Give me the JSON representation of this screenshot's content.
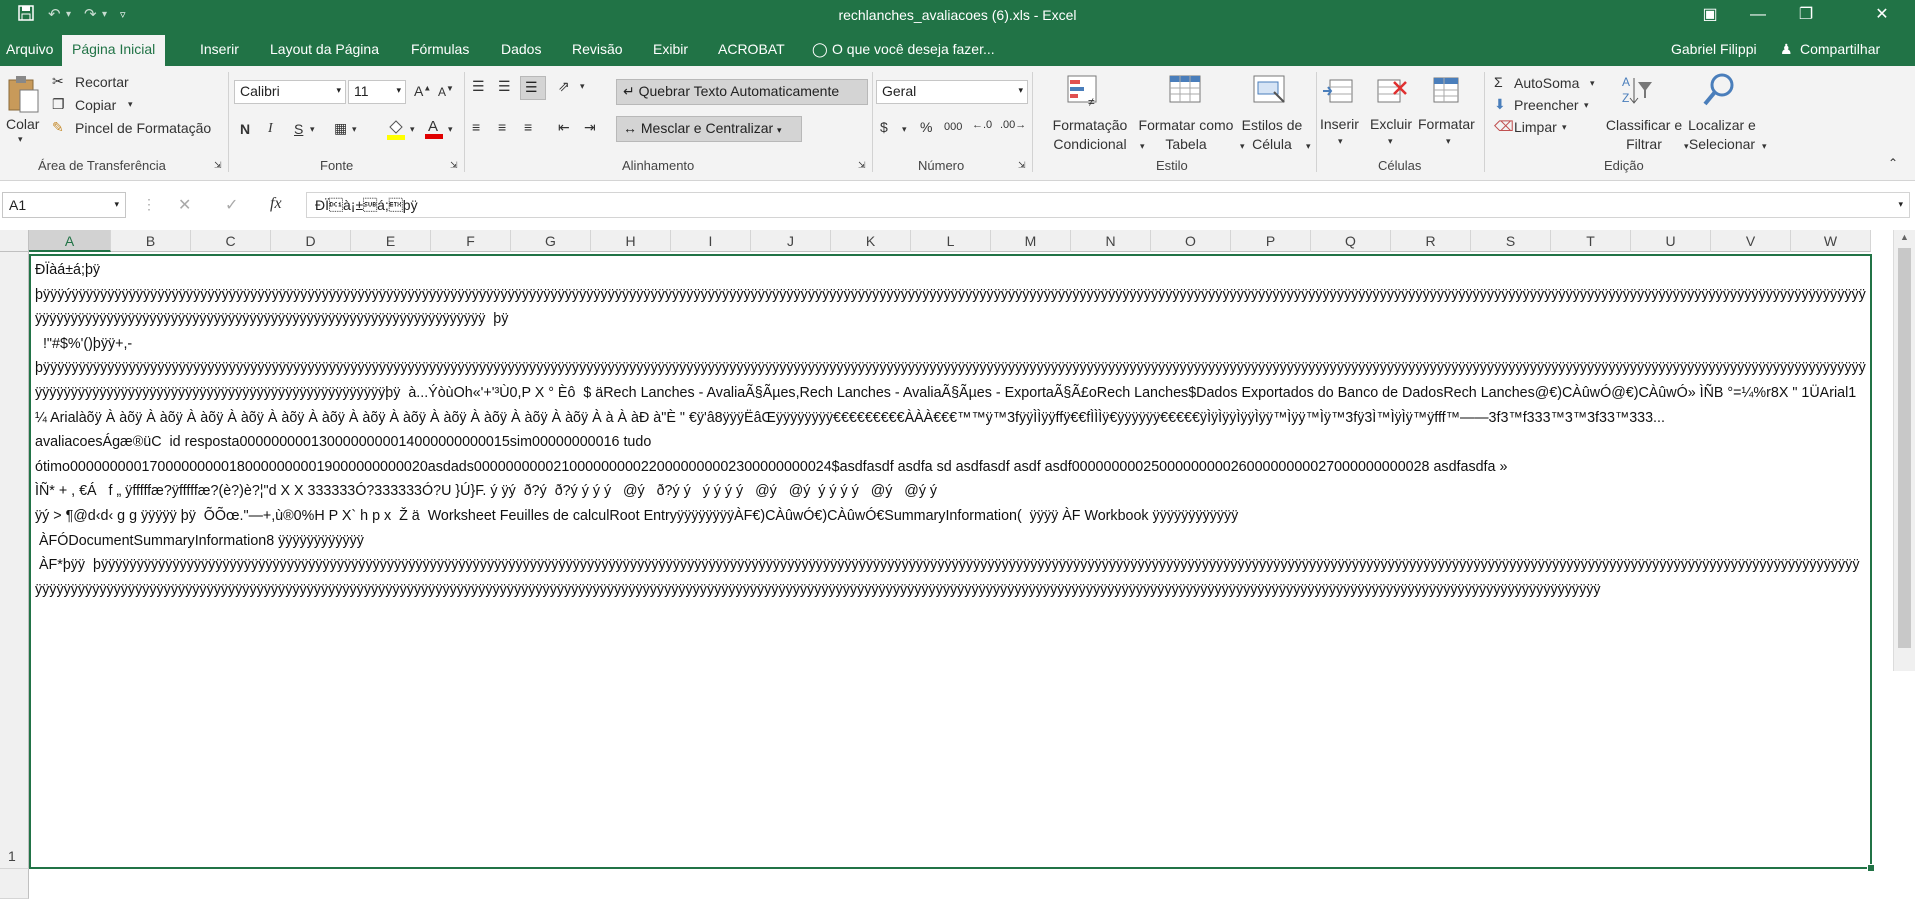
{
  "window": {
    "title": "rechlanches_avaliacoes (6).xls  -  Excel",
    "qa_icons": [
      "save-icon",
      "undo-icon",
      "redo-icon",
      "customize-icon"
    ]
  },
  "menu": {
    "tabs": [
      "Arquivo",
      "Página Inicial",
      "Inserir",
      "Layout da Página",
      "Fórmulas",
      "Dados",
      "Revisão",
      "Exibir",
      "ACROBAT"
    ],
    "tellme": "O que você deseja fazer...",
    "user": "Gabriel Filippi",
    "share": "Compartilhar"
  },
  "ribbon": {
    "clipboard": {
      "paste": "Colar",
      "cut": "Recortar",
      "copy": "Copiar",
      "format_painter": "Pincel de Formatação",
      "group": "Área de Transferência"
    },
    "font": {
      "name": "Calibri",
      "size": "11",
      "group": "Fonte",
      "bold": "N",
      "italic": "I",
      "underline": "S"
    },
    "alignment": {
      "wrap": "Quebrar Texto Automaticamente",
      "merge": "Mesclar e Centralizar",
      "group": "Alinhamento"
    },
    "number": {
      "format": "Geral",
      "currency": "$",
      "percent": "%",
      "thousands": "000",
      "group": "Número"
    },
    "styles": {
      "conditional": "Formatação Condicional",
      "as_table": "Formatar como Tabela",
      "cell_styles": "Estilos de Célula",
      "group": "Estilo"
    },
    "cells": {
      "insert": "Inserir",
      "delete": "Excluir",
      "format": "Formatar",
      "group": "Células"
    },
    "editing": {
      "autosum": "AutoSoma",
      "fill": "Preencher",
      "clear": "Limpar",
      "sort": "Classificar e Filtrar",
      "find": "Localizar e Selecionar",
      "group": "Edição"
    }
  },
  "formula_bar": {
    "name_box": "A1",
    "fx": "fx",
    "content": "ÐÏ\u0011à¡±\u001aá;\u0003þÿ"
  },
  "grid": {
    "columns": [
      "A",
      "B",
      "C",
      "D",
      "E",
      "F",
      "G",
      "H",
      "I",
      "J",
      "K",
      "L",
      "M",
      "N",
      "O",
      "P",
      "Q",
      "R",
      "S",
      "T",
      "U",
      "V",
      "W"
    ],
    "row_number": "1",
    "cell_a1": "ÐÏàá±á;þÿ\nþÿÿÿýÿÿÿÿÿÿÿÿÿÿÿÿÿÿÿÿÿÿÿÿÿÿÿÿÿÿÿÿÿÿÿÿÿÿÿÿÿÿÿÿÿÿÿÿÿÿÿÿÿÿÿÿÿÿÿÿÿÿÿÿÿÿÿÿÿÿÿÿÿÿÿÿÿÿÿÿÿÿÿÿÿÿÿÿÿÿÿÿÿÿÿÿÿÿÿÿÿÿÿÿÿÿÿÿÿÿÿÿÿÿÿÿÿÿÿÿÿÿÿÿÿÿÿÿÿÿÿÿÿÿÿÿÿÿÿÿÿÿÿÿÿÿÿÿÿÿÿÿÿÿÿÿÿÿÿÿÿÿÿÿÿÿÿÿÿÿÿÿÿÿÿÿÿÿÿÿÿÿÿÿÿÿÿÿÿÿÿÿÿÿÿÿÿÿÿÿÿÿÿÿÿÿÿÿÿÿÿÿÿÿÿÿÿÿÿÿÿÿÿÿÿÿÿÿÿÿÿÿÿÿÿÿÿÿÿÿÿÿÿÿÿÿÿÿÿÿÿÿÿÿÿÿÿÿÿÿÿÿÿÿÿÿÿÿÿÿÿÿÿÿÿÿÿÿÿÿÿÿÿÿÿÿÿÿÿÿÿÿÿÿÿÿÿÿÿÿÿÿÿÿÿÿÿÿÿÿÿÿÿÿÿÿÿÿ  þÿ  \n  !\"#$%'()þÿÿ+,-\nþÿÿÿÿÿÿÿÿÿÿÿÿÿÿÿÿÿÿÿÿÿÿÿÿÿÿÿÿÿÿÿÿÿÿÿÿÿÿÿÿÿÿÿÿÿÿÿÿÿÿÿÿÿÿÿÿÿÿÿÿÿÿÿÿÿÿÿÿÿÿÿÿÿÿÿÿÿÿÿÿÿÿÿÿÿÿÿÿÿÿÿÿÿÿÿÿÿÿÿÿÿÿÿÿÿÿÿÿÿÿÿÿÿÿÿÿÿÿÿÿÿÿÿÿÿÿÿÿÿÿÿÿÿÿÿÿÿÿÿÿÿÿÿÿÿÿÿÿÿÿÿÿÿÿÿÿÿÿÿÿÿÿÿÿÿÿÿÿÿÿÿÿÿÿÿÿÿÿÿÿÿÿÿÿÿÿÿÿÿÿÿÿÿÿÿÿÿÿÿÿÿÿÿÿÿÿÿÿÿÿÿÿÿÿÿÿÿÿÿÿÿÿÿÿÿÿÿÿÿÿÿÿÿÿÿÿÿÿÿÿÿÿÿÿÿÿÿÿÿÿÿÿÿÿÿÿÿÿÿÿÿÿÿÿÿÿÿÿÿÿÿÿÿÿÿÿÿÿÿÿÿÿÿÿÿÿÿÿÿÿÿÿÿÿÿÿÿÿÿÿÿÿÿÿþÿ  à...ÝòùOh«'+'³Ù0,P X ° Èô  $ äRech Lanches - AvaliaÃ§Ãµes,Rech Lanches - AvaliaÃ§Ãµes - ExportaÃ§Ã£oRech Lanches$Dados Exportados do Banco de DadosRech Lanches@€)CÀûwÓ@€)CÀûwÓ» ÌÑB °=¼%r8X \" 1ÜArial1¼ Arialàõÿ À àõÿ À àõÿ À àõÿ À àõÿ À àõÿ À àõÿ À àõÿ À àõÿ À àõÿ À àõÿ À àõÿ À àõÿ À à À àÐ à\"È \" €ÿ'â8ÿÿÿËâŒÿÿÿÿÿÿÿÿ€€€€€€€€€ÀÀÀ€€€™™ÿ™3fÿÿÌÌÿÿffÿ€€fÌÌÌÿ€ÿÿÿÿÿÿ€€€€€ÿÌÿÌÿÿÌÿÿÌÿÿ™Ìÿÿ™Ìÿ™3fÿ3Ì™ÌÿÌÿ™ÿfff™——3f3™f333™3™3f33™333...\navaliacoesÁgæ®üC  id resposta0000000001300000000014000000000015sim00000000016 tudo\nótimo000000000170000000001800000000019000000000020asdads000000000021000000000220000000002300000000024$asdfasdf asdfa sd asdfasdf asdf asdf000000000250000000002600000000027000000000028 asdfasdfa »\nÌÑ* + , €Á   f „ ÿfffffæ?ÿfffffæ?(è?)è?¦\"d X X 333333Ó?333333Ó?U }Ú}F. ý ÿý  ð?ý  ð?ý ý ý ý   @ý   ð?ý ý   ý ý ý ý   @ý   @ý  ý ý ý ý   @ý   @ý ý\nÿý > ¶@d‹d‹ g g ÿÿÿÿÿ þÿ  ÕÕœ.\"—+,ù®0%H P X` h p x  Ž ä  Worksheet Feuilles de calculRoot EntryÿÿÿÿÿÿÿÿÀF€)CÀûwÓ€)CÀûwÓ€SummaryInformation(  ÿÿÿÿ ÀF Workbook ÿÿÿÿÿÿÿÿÿÿÿÿ\n ÀFÓDocumentSummaryInformation8 ÿÿÿÿÿÿÿÿÿÿÿÿ\n ÀF*þÿÿ  þÿÿÿÿÿÿÿÿÿÿÿÿÿÿÿÿÿÿÿÿÿÿÿÿÿÿÿÿÿÿÿÿÿÿÿÿÿÿÿÿÿÿÿÿÿÿÿÿÿÿÿÿÿÿÿÿÿÿÿÿÿÿÿÿÿÿÿÿÿÿÿÿÿÿÿÿÿÿÿÿÿÿÿÿÿÿÿÿÿÿÿÿÿÿÿÿÿÿÿÿÿÿÿÿÿÿÿÿÿÿÿÿÿÿÿÿÿÿÿÿÿÿÿÿÿÿÿÿÿÿÿÿÿÿÿÿÿÿÿÿÿÿÿÿÿÿÿÿÿÿÿÿÿÿÿÿÿÿÿÿÿÿÿÿÿÿÿÿÿÿÿÿÿÿÿÿÿÿÿÿÿÿÿÿÿÿÿÿÿÿÿÿÿÿÿÿÿÿÿÿÿÿÿÿÿÿÿÿÿÿÿÿÿÿÿÿÿÿÿÿÿÿÿÿÿÿÿÿÿÿÿÿÿÿÿÿÿÿÿÿÿÿÿÿÿÿÿÿÿÿÿÿÿÿÿÿÿÿÿÿÿÿÿÿÿÿÿÿÿÿÿÿÿÿÿÿÿÿÿÿÿÿÿÿÿÿÿÿÿÿÿÿÿÿÿÿÿÿÿÿÿÿÿÿÿÿÿÿÿÿÿÿÿÿÿÿÿÿÿÿÿÿÿÿÿÿÿÿÿÿÿÿÿÿÿÿÿÿÿÿÿÿÿÿÿÿÿÿÿÿÿÿÿÿÿÿÿÿÿÿÿÿÿÿÿÿÿÿÿÿÿÿÿÿÿÿÿÿÿÿÿÿÿÿÿÿÿÿÿÿÿÿÿÿÿÿÿÿÿÿÿÿÿÿÿÿÿÿÿÿÿÿÿÿÿÿÿÿÿÿÿÿÿÿÿÿÿÿÿÿÿÿÿÿÿÿÿÿÿÿÿÿÿÿÿÿÿÿÿÿÿÿÿÿÿÿÿÿÿÿÿÿÿÿÿ"
  },
  "colors": {
    "accent": "#217346",
    "ribbon_bg": "#f3f3f3",
    "header_bg": "#f0f0f0"
  }
}
